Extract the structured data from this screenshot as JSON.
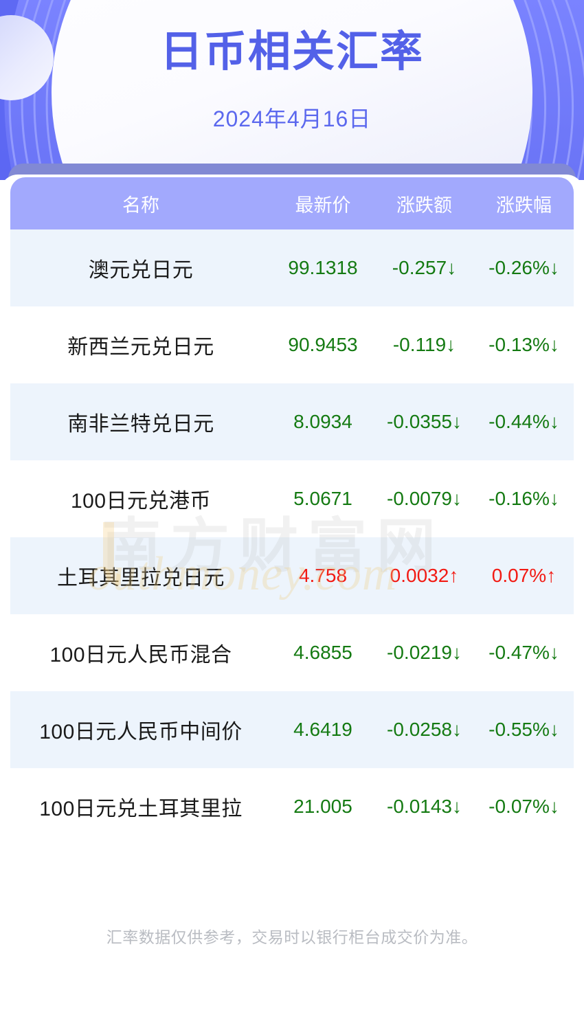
{
  "banner": {
    "title": "日币相关汇率",
    "date": "2024年4月16日",
    "title_color": "#5361e8",
    "date_color": "#5b68ee",
    "background_color": "#6b74f8"
  },
  "table": {
    "header": {
      "name": "名称",
      "price": "最新价",
      "change": "涨跌额",
      "percent": "涨跌幅",
      "background_color": "#a2a9fd",
      "text_color": "#ffffff"
    },
    "colors": {
      "down": "#147a12",
      "up": "#f21a13",
      "row_alt": "#edf4fc",
      "row_base": "#ffffff"
    },
    "rows": [
      {
        "name": "澳元兑日元",
        "price": "99.1318",
        "change": "-0.257↓",
        "percent": "-0.26%↓",
        "direction": "down"
      },
      {
        "name": "新西兰元兑日元",
        "price": "90.9453",
        "change": "-0.119↓",
        "percent": "-0.13%↓",
        "direction": "down"
      },
      {
        "name": "南非兰特兑日元",
        "price": "8.0934",
        "change": "-0.0355↓",
        "percent": "-0.44%↓",
        "direction": "down"
      },
      {
        "name": "100日元兑港币",
        "price": "5.0671",
        "change": "-0.0079↓",
        "percent": "-0.16%↓",
        "direction": "down"
      },
      {
        "name": "土耳其里拉兑日元",
        "price": "4.758",
        "change": "0.0032↑",
        "percent": "0.07%↑",
        "direction": "up"
      },
      {
        "name": "100日元人民币混合",
        "price": "4.6855",
        "change": "-0.0219↓",
        "percent": "-0.47%↓",
        "direction": "down"
      },
      {
        "name": "100日元人民币中间价",
        "price": "4.6419",
        "change": "-0.0258↓",
        "percent": "-0.55%↓",
        "direction": "down"
      },
      {
        "name": "100日元兑土耳其里拉",
        "price": "21.005",
        "change": "-0.0143↓",
        "percent": "-0.07%↓",
        "direction": "down"
      }
    ]
  },
  "watermark": {
    "chinese": "南方财富网",
    "english": "outhmoney.com"
  },
  "footer": {
    "disclaimer": "汇率数据仅供参考，交易时以银行柜台成交价为准。"
  }
}
